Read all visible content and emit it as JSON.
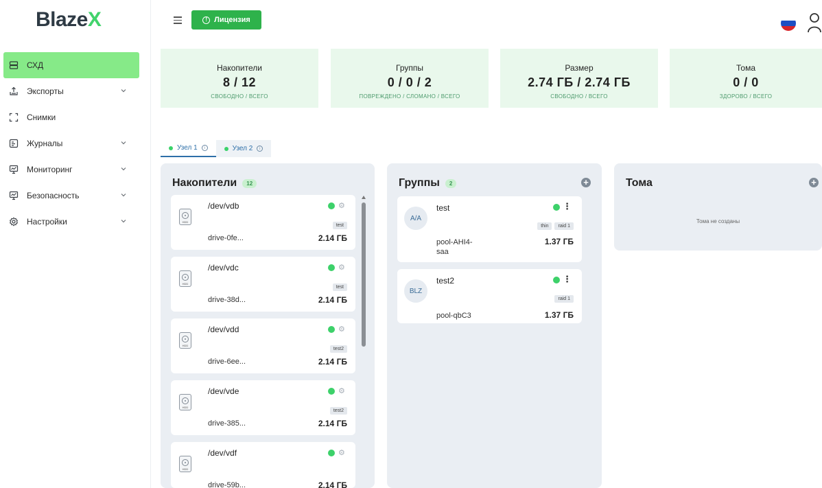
{
  "brand": {
    "name_main": "Blaze",
    "name_accent": "X"
  },
  "sidebar": {
    "items": [
      {
        "label": "СХД",
        "icon": "storage-icon",
        "active": true,
        "has_children": false
      },
      {
        "label": "Экспорты",
        "icon": "export-icon",
        "active": false,
        "has_children": true
      },
      {
        "label": "Снимки",
        "icon": "snapshot-icon",
        "active": false,
        "has_children": false
      },
      {
        "label": "Журналы",
        "icon": "log-icon",
        "active": false,
        "has_children": true
      },
      {
        "label": "Мониторинг",
        "icon": "monitor-icon",
        "active": false,
        "has_children": true
      },
      {
        "label": "Безопасность",
        "icon": "security-icon",
        "active": false,
        "has_children": true
      },
      {
        "label": "Настройки",
        "icon": "gear-icon",
        "active": false,
        "has_children": true
      }
    ]
  },
  "topbar": {
    "license_label": "Лицензия",
    "language_flag": "ru-flag-icon",
    "user_icon": "user-icon"
  },
  "stats": [
    {
      "title": "Накопители",
      "value": "8 / 12",
      "subtitle": "СВОБОДНО / ВСЕГО"
    },
    {
      "title": "Группы",
      "value": "0 / 0 / 2",
      "subtitle": "ПОВРЕЖДЕНО / СЛОМАНО / ВСЕГО"
    },
    {
      "title": "Размер",
      "value": "2.74 ГБ / 2.74 ГБ",
      "subtitle": "СВОБОДНО / ВСЕГО"
    },
    {
      "title": "Тома",
      "value": "0 / 0",
      "subtitle": "ЗДОРОВО / ВСЕГО"
    }
  ],
  "node_tabs": [
    {
      "label": "Узел 1",
      "active": true
    },
    {
      "label": "Узел 2",
      "active": false
    }
  ],
  "drives_panel": {
    "title": "Накопители",
    "count": "12",
    "drives": [
      {
        "device": "/dev/vdb",
        "tag": "test",
        "id": "drive-0fe...",
        "size": "2.14 ГБ",
        "hdd_label": "HDD"
      },
      {
        "device": "/dev/vdc",
        "tag": "test",
        "id": "drive-38d...",
        "size": "2.14 ГБ",
        "hdd_label": "HDD"
      },
      {
        "device": "/dev/vdd",
        "tag": "test2",
        "id": "drive-6ee...",
        "size": "2.14 ГБ",
        "hdd_label": "HDD"
      },
      {
        "device": "/dev/vde",
        "tag": "test2",
        "id": "drive-385...",
        "size": "2.14 ГБ",
        "hdd_label": "HDD"
      },
      {
        "device": "/dev/vdf",
        "tag": "",
        "id": "drive-59b...",
        "size": "2.14 ГБ",
        "hdd_label": "HDD"
      }
    ]
  },
  "groups_panel": {
    "title": "Группы",
    "count": "2",
    "groups": [
      {
        "avatar": "A/A",
        "name": "test",
        "tags": [
          "thin",
          "raid 1"
        ],
        "pool": "pool-AHI4-saa",
        "size": "1.37 ГБ"
      },
      {
        "avatar": "BLZ",
        "name": "test2",
        "tags": [
          "raid 1"
        ],
        "pool": "pool-qbC3",
        "size": "1.37 ГБ"
      }
    ]
  },
  "volumes_panel": {
    "title": "Тома",
    "empty_text": "Тома не созданы"
  },
  "colors": {
    "accent_green": "#2eb24b",
    "active_menu": "#86ea88",
    "status_ok": "#3dd16a",
    "stat_bg": "#e9f8ec",
    "panel_bg": "#eaeef3"
  }
}
